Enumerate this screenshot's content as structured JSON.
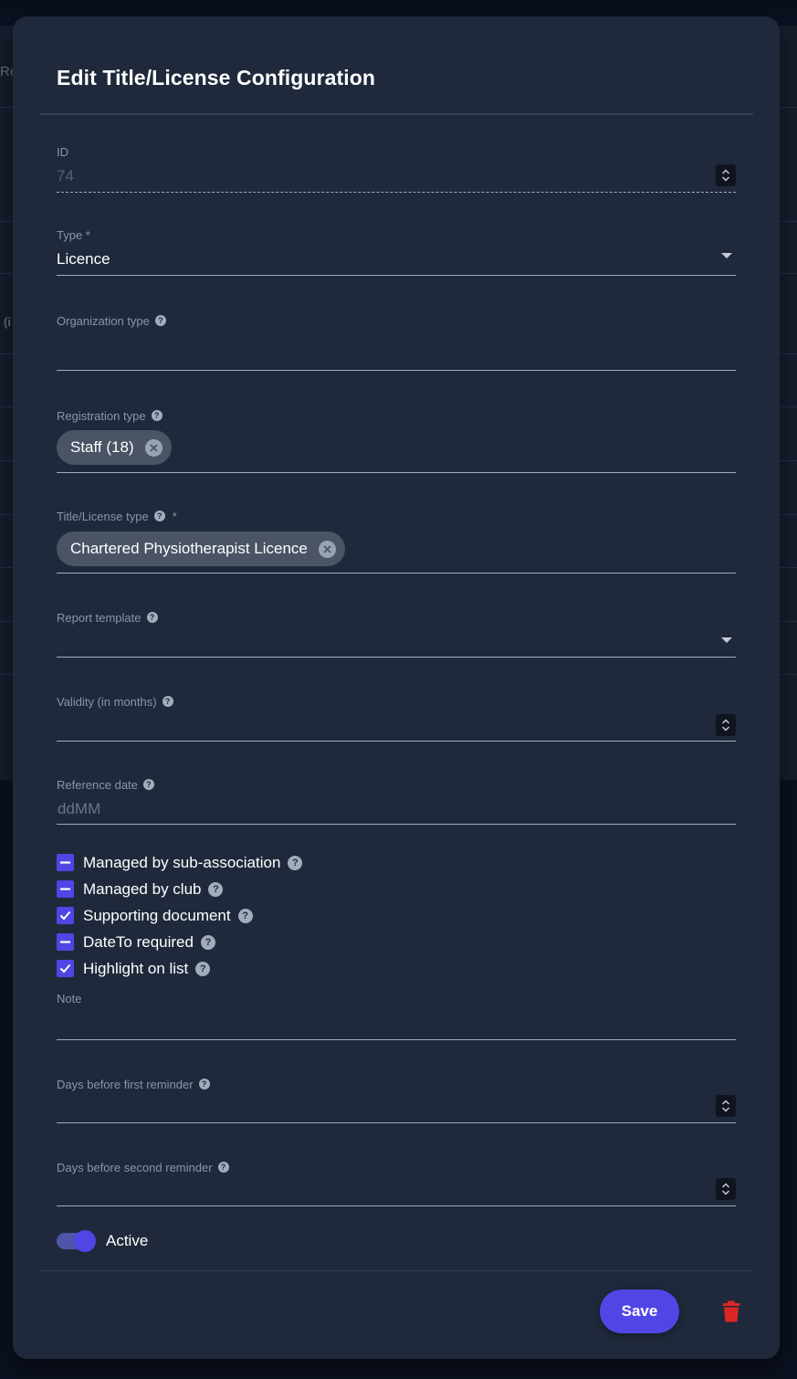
{
  "background": {
    "text_re": "Re",
    "text_i": "(i"
  },
  "modal": {
    "title": "Edit Title/License Configuration"
  },
  "fields": {
    "id": {
      "label": "ID",
      "value": "74"
    },
    "type": {
      "label": "Type *",
      "value": "Licence"
    },
    "organization_type": {
      "label": "Organization type",
      "value": ""
    },
    "registration_type": {
      "label": "Registration type",
      "chips": [
        "Staff (18)"
      ]
    },
    "title_license_type": {
      "label": "Title/License type",
      "required_mark": "*",
      "chips": [
        "Chartered Physiotherapist Licence"
      ]
    },
    "report_template": {
      "label": "Report template",
      "value": ""
    },
    "validity": {
      "label": "Validity (in months)",
      "value": ""
    },
    "reference_date": {
      "label": "Reference date",
      "placeholder": "ddMM"
    },
    "note": {
      "label": "Note",
      "value": ""
    },
    "days_first_reminder": {
      "label": "Days before first reminder",
      "value": ""
    },
    "days_second_reminder": {
      "label": "Days before second reminder",
      "value": ""
    }
  },
  "checkboxes": [
    {
      "label": "Managed by sub-association",
      "state": "indeterminate"
    },
    {
      "label": "Managed by club",
      "state": "indeterminate"
    },
    {
      "label": "Supporting document",
      "state": "checked"
    },
    {
      "label": "DateTo required",
      "state": "indeterminate"
    },
    {
      "label": "Highlight on list",
      "state": "checked"
    }
  ],
  "active_toggle": {
    "label": "Active",
    "on": true
  },
  "footer": {
    "save_label": "Save"
  },
  "icons": {
    "help": "question-circle-icon",
    "delete": "trash-icon",
    "chip_remove": "close-circle-icon"
  },
  "colors": {
    "accent": "#5046e5",
    "modal_bg": "#1f293b",
    "danger": "#dc2626"
  }
}
